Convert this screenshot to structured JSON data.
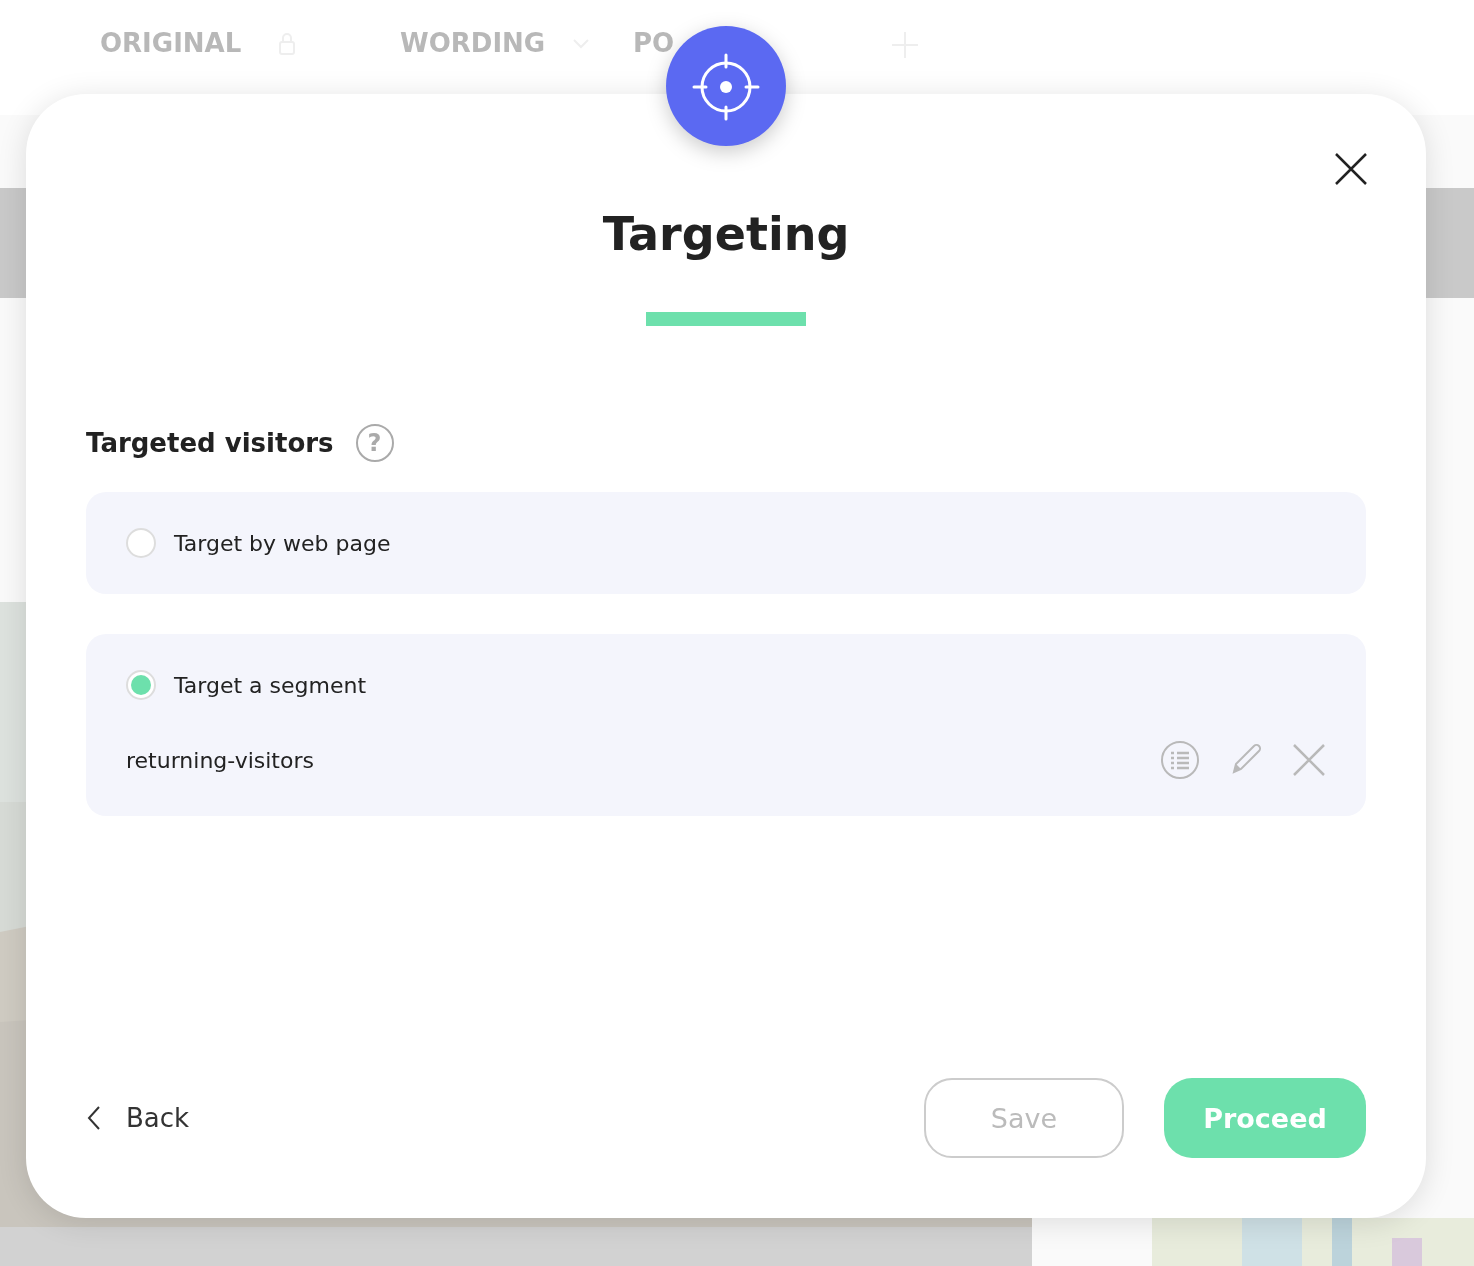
{
  "background": {
    "nav_items": [
      {
        "label": "ORIGINAL"
      },
      {
        "label": "WORDING"
      },
      {
        "label": "PO"
      }
    ]
  },
  "modal": {
    "title": "Targeting",
    "section": {
      "label": "Targeted visitors",
      "help": "?"
    },
    "options": [
      {
        "label": "Target by web page",
        "selected": false
      },
      {
        "label": "Target a segment",
        "selected": true,
        "segment": "returning-visitors"
      }
    ],
    "footer": {
      "back": "Back",
      "buttons": [
        {
          "label": "Save",
          "kind": "outline"
        },
        {
          "label": "Proceed",
          "kind": "primary"
        }
      ]
    }
  }
}
